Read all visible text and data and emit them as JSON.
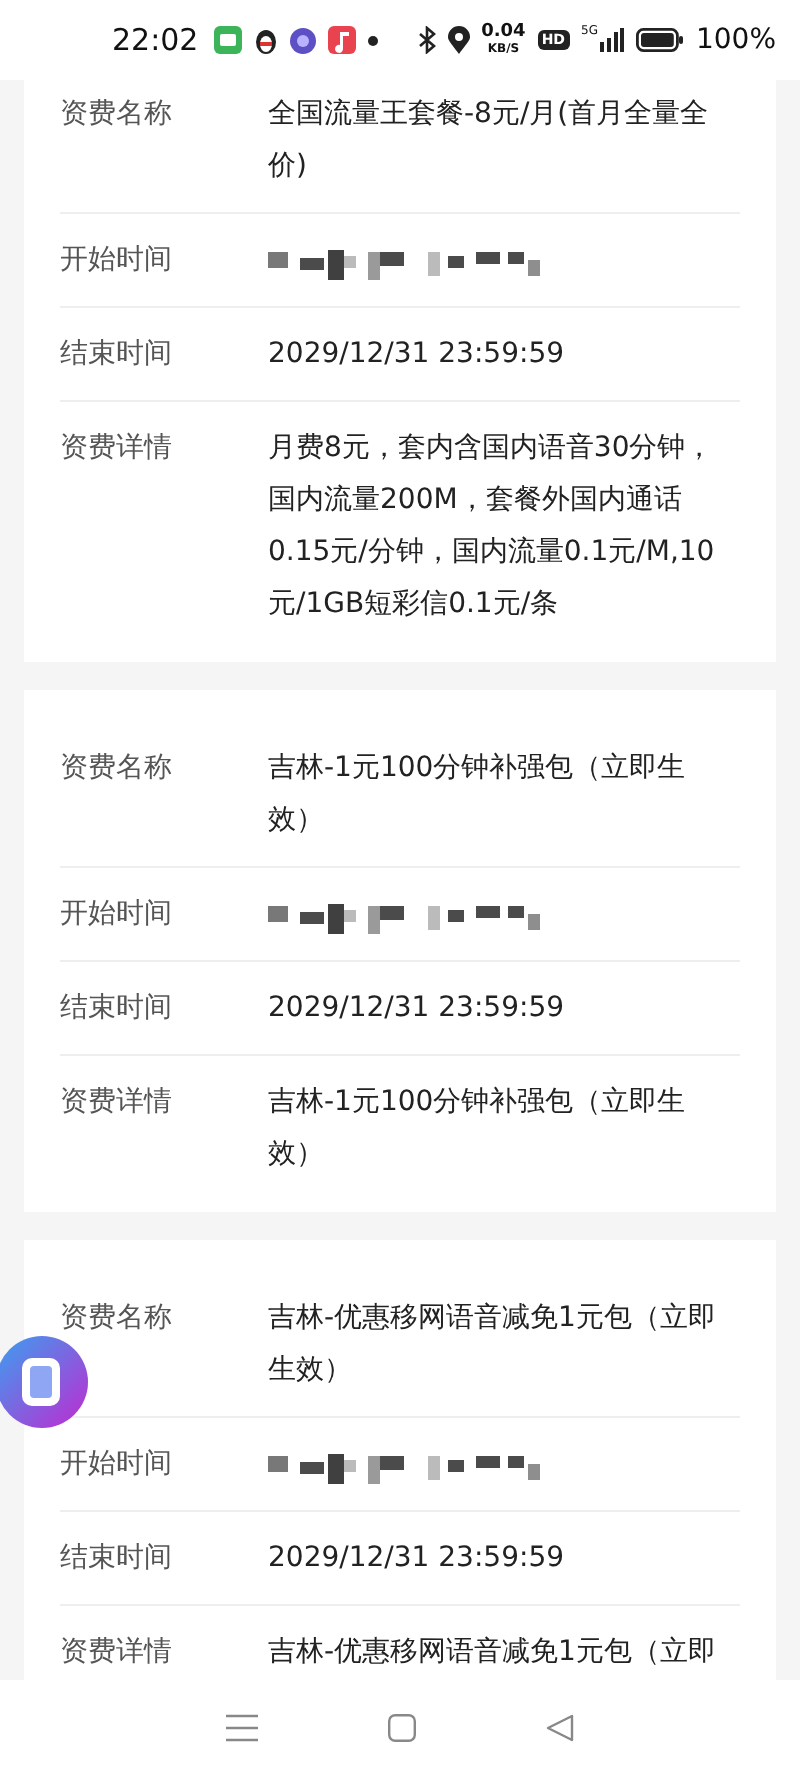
{
  "status_bar": {
    "time": "22:02",
    "net_speed": "0.04",
    "net_unit": "KB/S",
    "hd": "HD",
    "network": "5G",
    "battery": "100%"
  },
  "cards": [
    {
      "rows": [
        {
          "kind": "text",
          "label": "资费名称",
          "value": "全国流量王套餐-8元/月(首月全量全价)"
        },
        {
          "kind": "mosaic",
          "label": "开始时间"
        },
        {
          "kind": "text",
          "label": "结束时间",
          "value": "2029/12/31 23:59:59"
        },
        {
          "kind": "text",
          "label": "资费详情",
          "value": "月费8元，套内含国内语音30分钟，国内流量200M，套餐外国内通话0.15元/分钟，国内流量0.1元/M,10元/1GB短彩信0.1元/条"
        }
      ]
    },
    {
      "rows": [
        {
          "kind": "text",
          "label": "资费名称",
          "value": "吉林-1元100分钟补强包（立即生效）"
        },
        {
          "kind": "mosaic",
          "label": "开始时间"
        },
        {
          "kind": "text",
          "label": "结束时间",
          "value": "2029/12/31 23:59:59"
        },
        {
          "kind": "text",
          "label": "资费详情",
          "value": "吉林-1元100分钟补强包（立即生效）"
        }
      ]
    },
    {
      "rows": [
        {
          "kind": "text",
          "label": "资费名称",
          "value": "吉林-优惠移网语音减免1元包（立即生效）"
        },
        {
          "kind": "mosaic",
          "label": "开始时间"
        },
        {
          "kind": "text",
          "label": "结束时间",
          "value": "2029/12/31 23:59:59"
        },
        {
          "kind": "text",
          "label": "资费详情",
          "value": "吉林-优惠移网语音减免1元包（立即"
        }
      ]
    }
  ]
}
